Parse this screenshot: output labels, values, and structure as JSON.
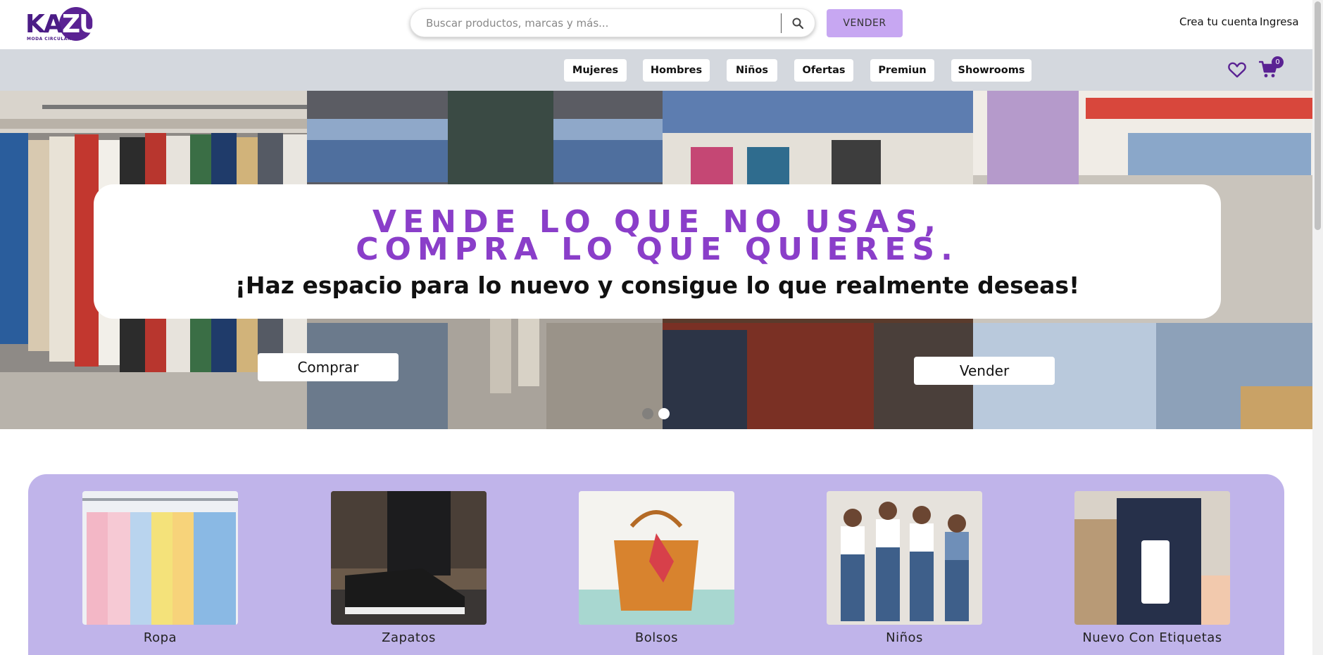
{
  "header": {
    "logo_text": "KAZU",
    "logo_subtitle": "MODA CIRCULAR",
    "search_placeholder": "Buscar productos, marcas y más...",
    "vender_label": "VENDER",
    "crea_cuenta_label": "Crea tu cuenta",
    "ingresa_label": "Ingresa"
  },
  "nav": {
    "items": [
      {
        "label": "Mujeres"
      },
      {
        "label": "Hombres"
      },
      {
        "label": "Niños"
      },
      {
        "label": "Ofertas"
      },
      {
        "label": "Premiun"
      },
      {
        "label": "Showrooms"
      }
    ],
    "cart_count": "0",
    "icons": [
      "heart-icon",
      "cart-icon"
    ]
  },
  "hero": {
    "line1": "VENDE LO QUE NO USAS,",
    "line2": "COMPRA LO QUE QUIERES.",
    "line3": "¡Haz espacio para lo nuevo y consigue lo que realmente deseas!",
    "buy_button": "Comprar",
    "sell_button": "Vender",
    "slides_total": 2,
    "active_slide": 2
  },
  "categories": [
    {
      "label": "Ropa"
    },
    {
      "label": "Zapatos"
    },
    {
      "label": "Bolsos"
    },
    {
      "label": "Niños"
    },
    {
      "label": "Nuevo Con Etiquetas"
    }
  ],
  "colors": {
    "brand": "#5a2293",
    "hero_text": "#8a3ec9",
    "vender_button": "#c7a7f2",
    "nav_bg": "#d4d8de",
    "categories_bg": "#c0b4ea"
  }
}
